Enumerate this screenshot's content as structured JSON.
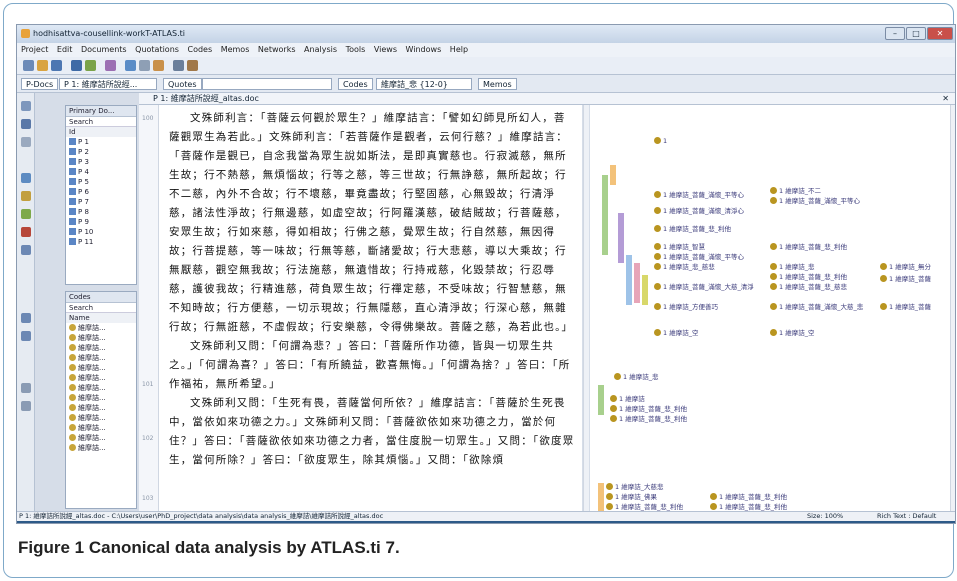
{
  "window": {
    "title": "hodhisattva-cousellink-workT-ATLAS.ti",
    "controls": [
      "–",
      "□",
      "✕"
    ]
  },
  "menu": [
    "Project",
    "Edit",
    "Documents",
    "Quotations",
    "Codes",
    "Memos",
    "Networks",
    "Analysis",
    "Tools",
    "Views",
    "Windows",
    "Help"
  ],
  "nav": {
    "pdocs": "P-Docs",
    "pdoc_value": "P 1: 維摩詰所說經...",
    "quotes": "Quotes",
    "codes": "Codes",
    "code_value": "維摩詰_悲 {12-0}",
    "memos": "Memos"
  },
  "doc_title": "P 1: 維摩詰所說經_altas.doc",
  "primary": {
    "header": "Primary Do...",
    "search": "Search",
    "col": "Id",
    "items": [
      "P 1",
      "P 2",
      "P 3",
      "P 4",
      "P 5",
      "P 6",
      "P 7",
      "P 8",
      "P 9",
      "P 10",
      "P 11"
    ]
  },
  "codes_panel": {
    "header": "Codes",
    "search": "Search",
    "col": "Name",
    "items": [
      "維摩詰...",
      "維摩詰...",
      "維摩詰...",
      "維摩詰...",
      "維摩詰...",
      "維摩詰...",
      "維摩詰...",
      "維摩詰...",
      "維摩詰...",
      "維摩詰...",
      "維摩詰...",
      "維摩詰...",
      "維摩詰..."
    ]
  },
  "line_numbers": [
    "100",
    "101",
    "102",
    "103"
  ],
  "document_paragraphs": [
    "文殊師利言：「菩薩云何觀於眾生？」維摩詰言：「譬如幻師見所幻人，菩薩觀眾生為若此。」文殊師利言：「若菩薩作是觀者，云何行慈？」維摩詰言：「菩薩作是觀已，自念我當為眾生說如斯法，是即真實慈也。行寂滅慈，無所生故；行不熱慈，無煩惱故；行等之慈，等三世故；行無諍慈，無所起故；行不二慈，內外不合故；行不壞慈，畢竟盡故；行堅固慈，心無毀故；行清淨慈，諸法性淨故；行無邊慈，如虛空故；行阿羅漢慈，破結賊故；行菩薩慈，安眾生故；行如來慈，得如相故；行佛之慈，覺眾生故；行自然慈，無因得故；行菩提慈，等一味故；行無等慈，斷諸愛故；行大悲慈，導以大乘故；行無厭慈，觀空無我故；行法施慈，無遺惜故；行持戒慈，化毀禁故；行忍辱慈，護彼我故；行精進慈，荷負眾生故；行禪定慈，不受味故；行智慧慈，無不知時故；行方便慈，一切示現故；行無隱慈，直心清淨故；行深心慈，無雜行故；行無誑慈，不虛假故；行安樂慈，令得佛樂故。菩薩之慈，為若此也。」",
    "文殊師利又問：「何謂為悲？」答曰：「菩薩所作功德，皆與一切眾生共之。」「何謂為喜？」答曰：「有所饒益，歡喜無悔。」「何謂為捨？」答曰：「所作福祐，無所希望。」",
    "文殊師利又問：「生死有畏，菩薩當何所依？」維摩詰言：「菩薩於生死畏中，當依如來功德之力。」文殊師利又問：「菩薩欲依如來功德之力，當於何住？」答曰：「菩薩欲依如來功德之力者，當住度脫一切眾生。」又問：「欲度眾生，當何所除？」答曰：「欲度眾生，除其煩惱。」又問：「欲除煩"
  ],
  "margin_codes": [
    "1",
    "1 維摩詰_菩薩_滿懷_平等心",
    "1 維摩詰_不二",
    "1 維摩詰_菩薩_滿懷_平等心",
    "1 維摩詰_菩薩_滿懷_清淨心",
    "1 維摩詰_菩薩_悲_利他",
    "1 維摩詰_智慧",
    "1 維摩詰_菩薩_悲_利他",
    "1 維摩詰_菩薩_滿懷_平等心",
    "1 維摩詰_悲_慈悲",
    "1 維摩詰_悲",
    "1 維摩詰_菩薩_悲_利他",
    "1 維摩詰_無分",
    "1 維摩詰_菩薩_滿懷_大慈_清淨",
    "1 維摩詰_菩薩_悲_慈悲",
    "1 維摩詰_菩薩",
    "1 維摩詰_方便善巧",
    "1 維摩詰_菩薩_滿懷_大慈_悲",
    "1 維摩詰_菩薩",
    "1 維摩詰_空",
    "1 維摩詰_空",
    "1 維摩詰_悲",
    "1 維摩詰",
    "1 維摩詰_菩薩_悲_利他",
    "1 維摩詰_菩薩_悲_利他",
    "1 維摩詰_大慈悲",
    "1 維摩詰_佛果",
    "1 維摩詰_菩薩_悲_利他",
    "1 維摩詰_菩薩_悲_利他",
    "1 維摩詰_菩薩_悲_利他"
  ],
  "status": {
    "path": "P 1: 維摩詰所說經_altas.doc - C:\\Users\\user\\PhD_project\\data analysis\\data analysis_維摩詰\\維摩詰所說經_altas.doc",
    "zoom": "Size: 100%",
    "mode": "Rich Text : Default"
  },
  "caption": {
    "label": "Figure 1",
    "text": "Canonical data analysis by ATLAS.ti 7."
  }
}
